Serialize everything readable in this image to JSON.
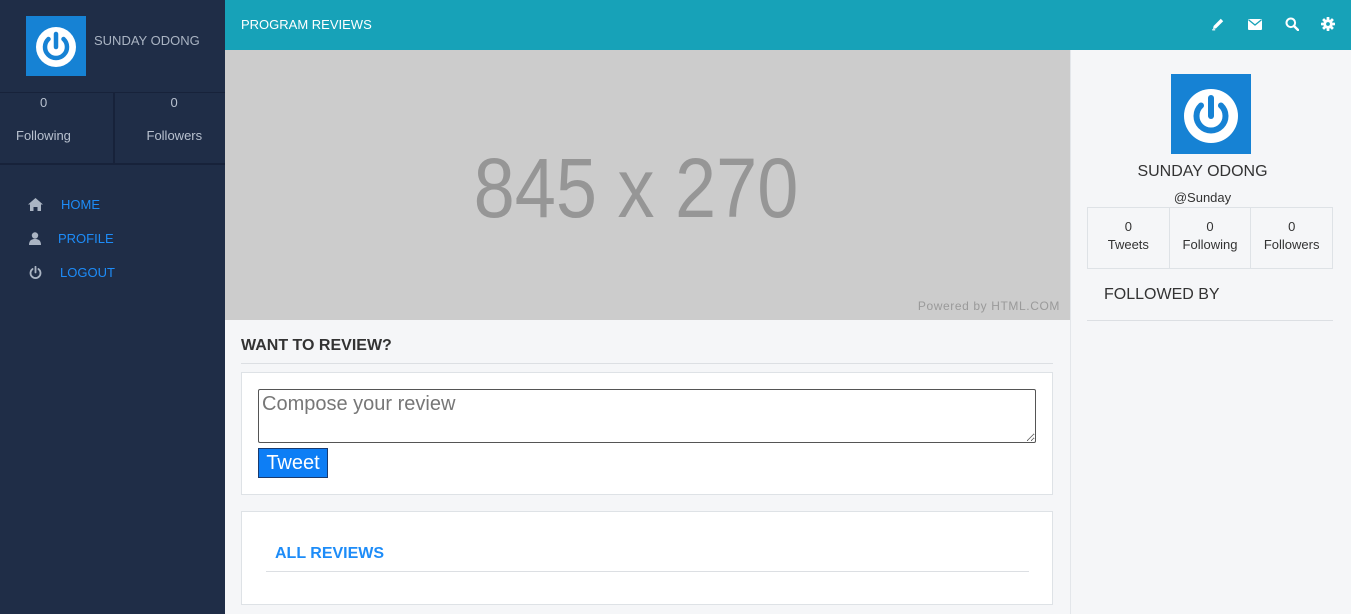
{
  "sidebar": {
    "user_name": "SUNDAY ODONG",
    "stats": [
      {
        "value": "0",
        "label": "Following"
      },
      {
        "value": "0",
        "label": "Followers"
      }
    ],
    "nav": [
      {
        "label": "HOME",
        "icon": "home-icon"
      },
      {
        "label": "PROFILE",
        "icon": "user-icon"
      },
      {
        "label": "LOGOUT",
        "icon": "power-icon"
      }
    ]
  },
  "topbar": {
    "title": "PROGRAM REVIEWS",
    "icons": [
      "pencil-icon",
      "envelope-icon",
      "search-icon",
      "gear-icon"
    ]
  },
  "banner": {
    "size_text": "845 x 270",
    "powered_by": "Powered by HTML.COM"
  },
  "review": {
    "heading": "WANT TO REVIEW?",
    "placeholder": "Compose your review",
    "value": "",
    "button_label": "Tweet"
  },
  "all_reviews": {
    "title": "ALL REVIEWS"
  },
  "profile_panel": {
    "name": "SUNDAY ODONG",
    "handle": "@Sunday",
    "stats": [
      {
        "value": "0",
        "label": "Tweets"
      },
      {
        "value": "0",
        "label": "Following"
      },
      {
        "value": "0",
        "label": "Followers"
      }
    ],
    "followed_by_label": "FOLLOWED BY"
  },
  "colors": {
    "sidebar_bg": "#1f2d47",
    "topbar_bg": "#17a2b8",
    "accent_blue": "#1d8cf8",
    "avatar_blue": "#1682d4",
    "button_blue": "#0d7ef5"
  }
}
